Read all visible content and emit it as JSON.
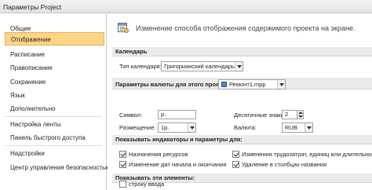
{
  "window": {
    "title": "Параметры Project"
  },
  "sidebar": {
    "items": [
      {
        "label": "Общие"
      },
      {
        "label": "Отображение"
      },
      {
        "label": "Расписание"
      },
      {
        "label": "Правописание"
      },
      {
        "label": "Сохранение"
      },
      {
        "label": "Язык"
      },
      {
        "label": "Дополнительно"
      },
      {
        "label": "Настройка ленты"
      },
      {
        "label": "Панель быстрого доступа"
      },
      {
        "label": "Надстройки"
      },
      {
        "label": "Центр управления безопасностью"
      }
    ],
    "selected": "Отображение",
    "selected_color": "#fdd587"
  },
  "content": {
    "header_text": "Изменение способа отображения содержимого проекта на экране.",
    "header_icon": "display-settings-icon",
    "calendar": {
      "section_title": "Календарь",
      "type_label": "Тип календаря:",
      "type_value": "Григорианский календарь"
    },
    "currency": {
      "section_title": "Параметры валюты для этого проекта:",
      "project_value": "Ремонт1.mpp",
      "symbol_label": "Символ:",
      "symbol_value": "р.",
      "decimals_label": "Десятичные знаки:",
      "decimals_value": "2",
      "placement_label": "Размещение:",
      "placement_value": "1р.",
      "currency_label": "Валюта:",
      "currency_value": "RUB"
    },
    "indicators": {
      "section_title": "Показывать индикаторы и параметры для:",
      "items": [
        {
          "label": "Назначения ресурсов",
          "checked": true
        },
        {
          "label": "Изменения трудозатрат, единиц или длительности",
          "checked": true
        },
        {
          "label": "Изменение дат начала и окончания",
          "checked": true
        },
        {
          "label": "Удаление в столбцах названия",
          "checked": true
        }
      ]
    },
    "show_elements": {
      "section_title": "Показывать эти элементы:",
      "items": [
        {
          "label": "строку ввода",
          "checked": false
        }
      ]
    }
  }
}
